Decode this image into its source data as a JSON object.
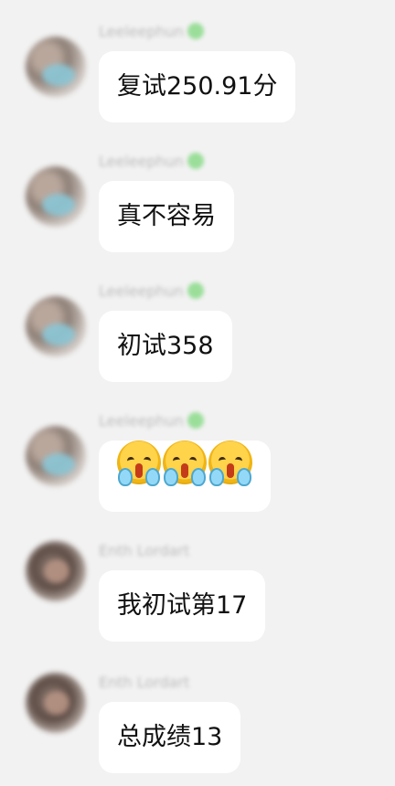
{
  "messages": [
    {
      "sender": "Leeleephun",
      "text": "复试250.91分"
    },
    {
      "sender": "Leeleephun",
      "text": "真不容易"
    },
    {
      "sender": "Leeleephun",
      "text": "初试358"
    },
    {
      "sender": "Leeleephun",
      "emoji_icon": "crying-face-icon"
    },
    {
      "sender": "Enth Lordart",
      "text": "我初试第17"
    },
    {
      "sender": "Enth Lordart",
      "text": "总成绩13"
    }
  ]
}
